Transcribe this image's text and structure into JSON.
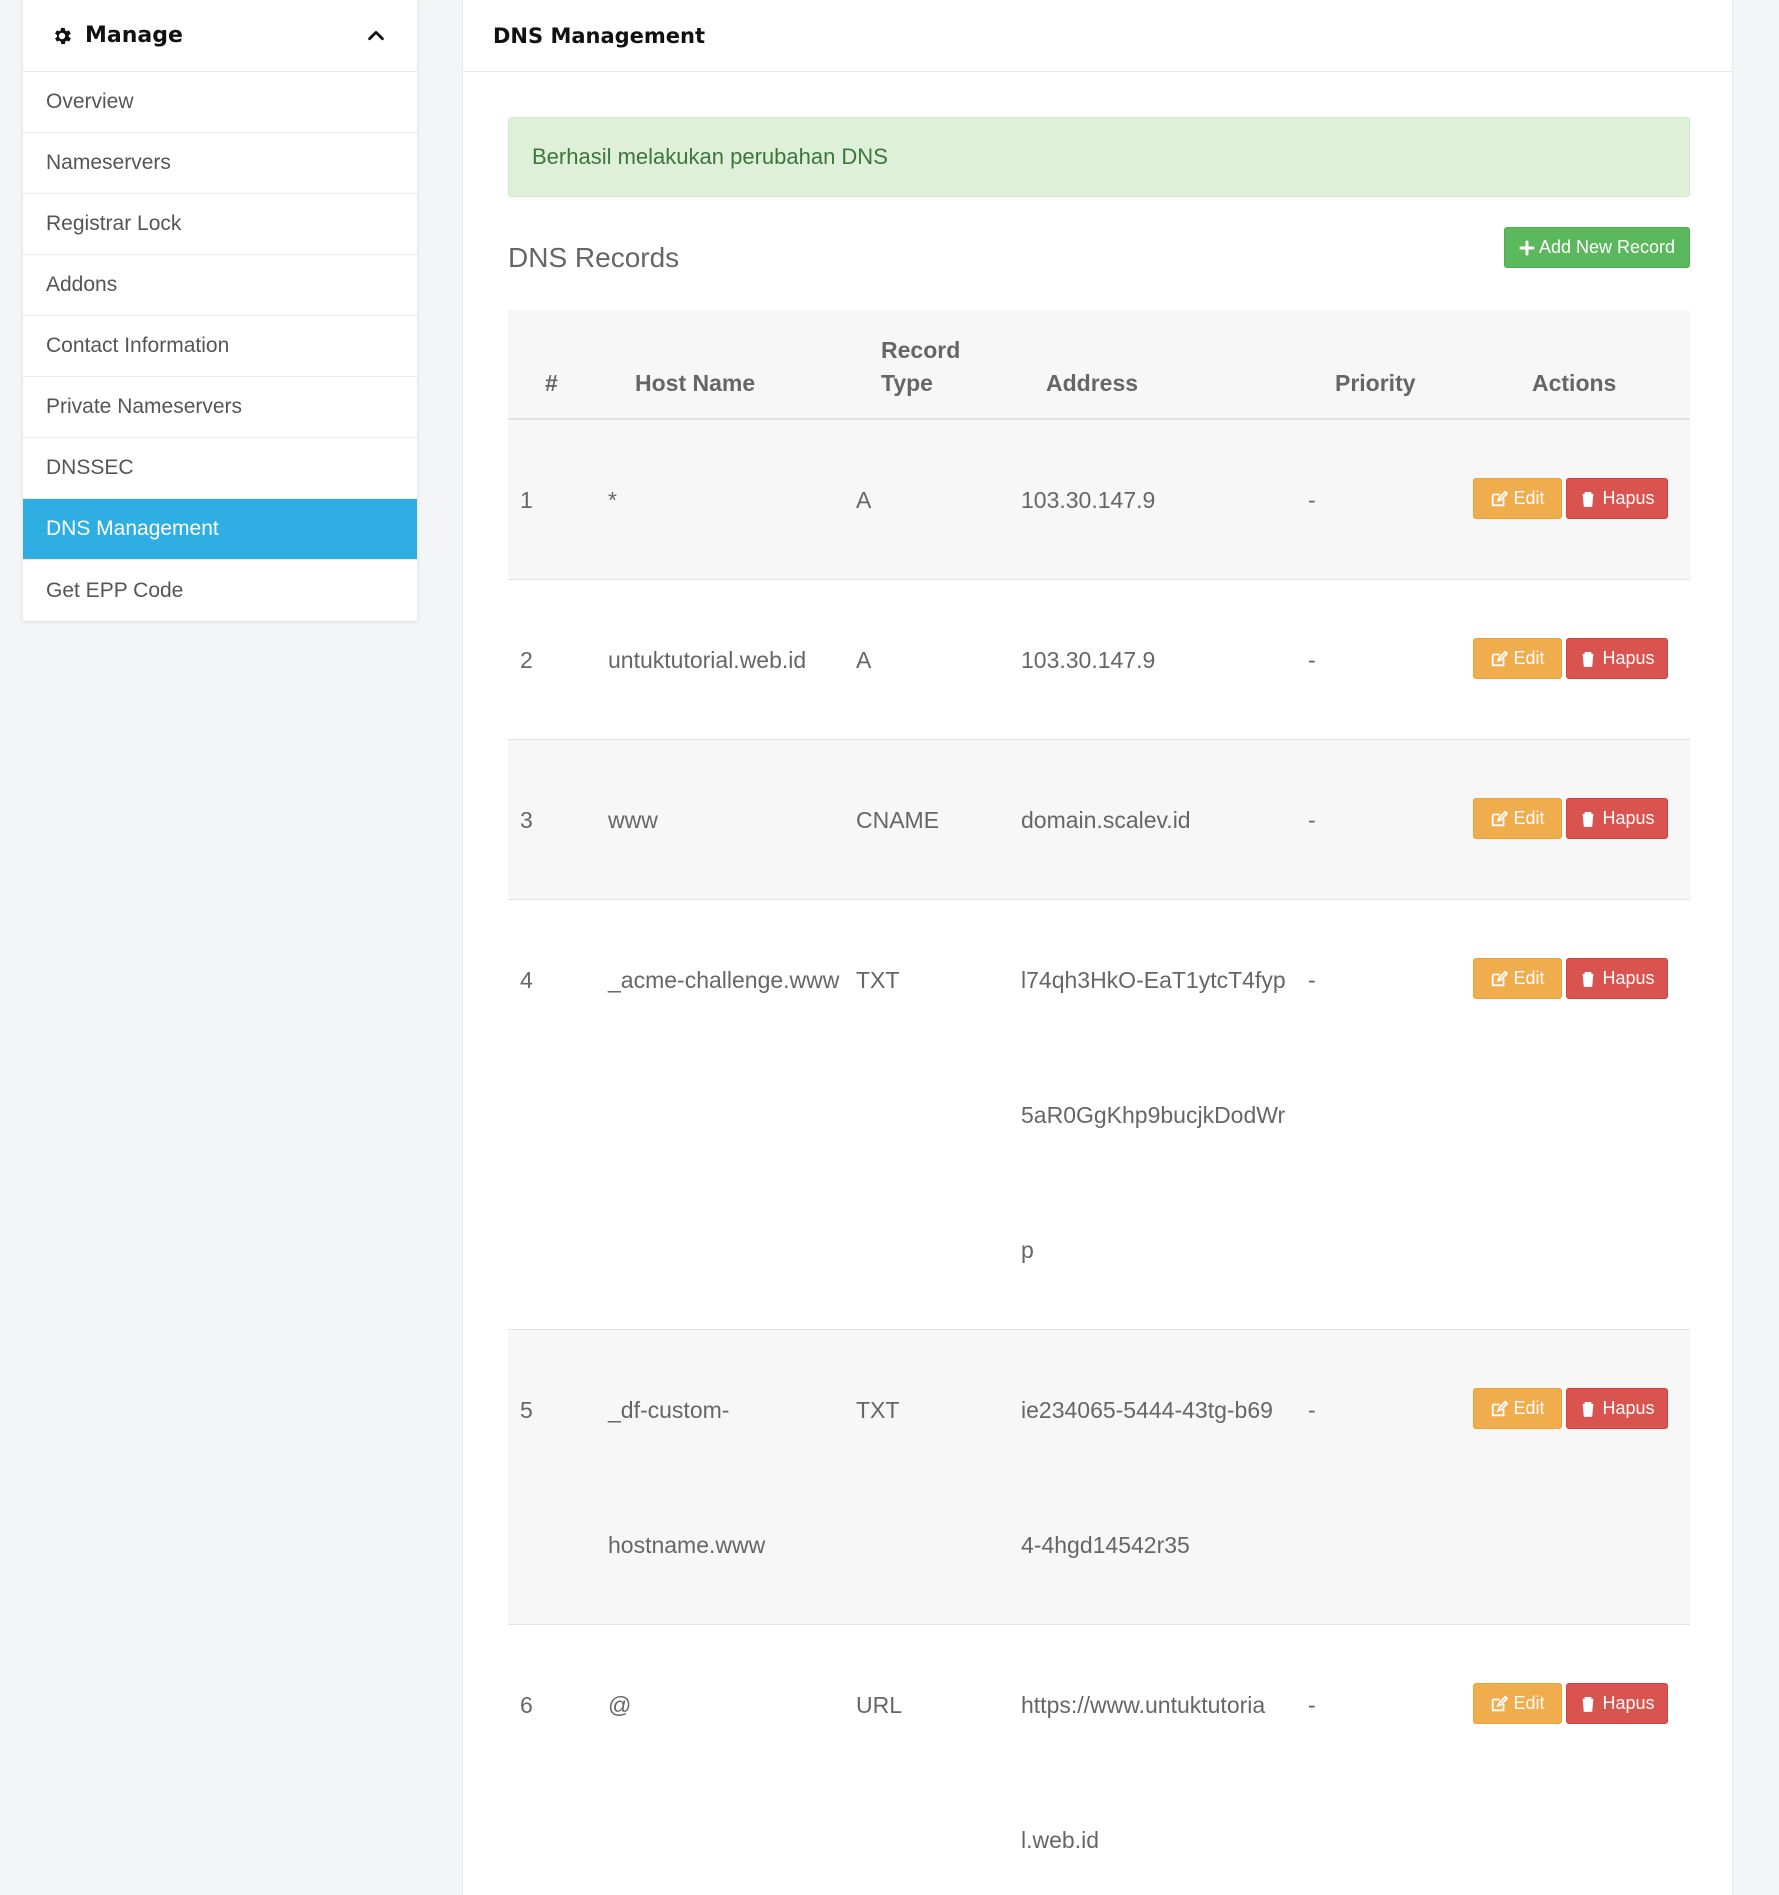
{
  "sidebar": {
    "title": "Manage",
    "items": [
      {
        "label": "Overview"
      },
      {
        "label": "Nameservers"
      },
      {
        "label": "Registrar Lock"
      },
      {
        "label": "Addons"
      },
      {
        "label": "Contact Information"
      },
      {
        "label": "Private Nameservers"
      },
      {
        "label": "DNSSEC"
      },
      {
        "label": "DNS Management",
        "active": true
      },
      {
        "label": "Get EPP Code"
      }
    ]
  },
  "main": {
    "title": "DNS Management",
    "alert": "Berhasil melakukan perubahan DNS",
    "section_title": "DNS Records",
    "add_button": "Add New Record",
    "table": {
      "headers": {
        "num": "#",
        "host": "Host Name",
        "type_line1": "Record",
        "type_line2": "Type",
        "address": "Address",
        "priority": "Priority",
        "actions": "Actions"
      },
      "edit_label": "Edit",
      "delete_label": "Hapus",
      "rows": [
        {
          "num": "1",
          "host": [
            "*"
          ],
          "type": "A",
          "address": [
            "103.30.147.9"
          ],
          "priority": "-"
        },
        {
          "num": "2",
          "host": [
            "untuktutorial.web.id"
          ],
          "type": "A",
          "address": [
            "103.30.147.9"
          ],
          "priority": "-"
        },
        {
          "num": "3",
          "host": [
            "www"
          ],
          "type": "CNAME",
          "address": [
            "domain.scalev.id"
          ],
          "priority": "-"
        },
        {
          "num": "4",
          "host": [
            "_acme-challenge.www"
          ],
          "type": "TXT",
          "address": [
            "l74qh3HkO-EaT1ytcT4fyp",
            "5aR0GgKhp9bucjkDodWr",
            "p"
          ],
          "priority": "-"
        },
        {
          "num": "5",
          "host": [
            "_df-custom-",
            "hostname.www"
          ],
          "type": "TXT",
          "address": [
            "ie234065-5444-43tg-b69",
            "4-4hgd14542r35"
          ],
          "priority": "-"
        },
        {
          "num": "6",
          "host": [
            "@"
          ],
          "type": "URL",
          "address": [
            "https://www.untuktutoria",
            "l.web.id"
          ],
          "priority": "-"
        }
      ]
    }
  },
  "colors": {
    "active": "#2eaee3",
    "success": "#5cb85c",
    "warning": "#f0ad4e",
    "danger": "#d9534f",
    "alert_bg": "#dff0d8"
  },
  "icons": {
    "sidebar_header": "gear-icon",
    "collapse": "chevron-up-icon",
    "add": "plus-icon",
    "edit": "edit-icon",
    "delete": "trash-icon"
  }
}
